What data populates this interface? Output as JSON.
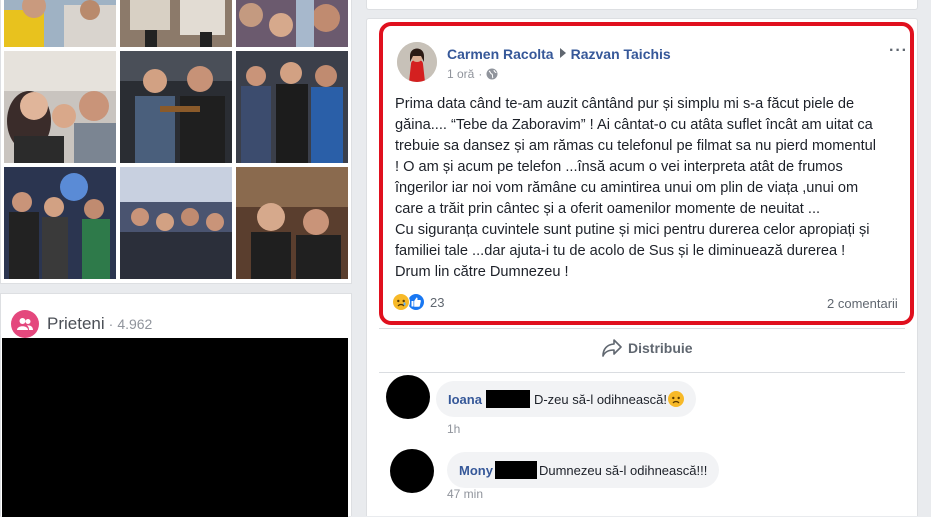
{
  "friends": {
    "title": "Prieteni",
    "separator": "·",
    "count": "4.962"
  },
  "post": {
    "author": "Carmen Racolta",
    "target": "Razvan Taichis",
    "time": "1 oră",
    "meta_dot": "·",
    "more": "···",
    "text_lines": [
      "Prima data când te-am auzit cântând pur și simplu mi s-a făcut piele de",
      "găina.... “Tebe da Zaboravim” ! Ai cântat-o cu atâta suflet încât am uitat ca",
      "trebuie sa dansez și am rămas cu telefonul pe filmat sa nu pierd momentul",
      "! O am și acum pe telefon ...însă acum o vei interpreta atât de frumos",
      "îngerilor iar noi vom rămâne cu amintirea unui om plin de viața ,unui om",
      "care a trăit prin cântec și a oferit oamenilor momente de neuitat ...",
      "Cu siguranța cuvintele sunt putine și mici pentru durerea celor apropiați și",
      "familiei tale ...dar ajuta-i tu de acolo de Sus și le diminuează durerea !",
      "Drum lin către Dumnezeu !"
    ],
    "reaction_count": "23",
    "comments_link": "2 comentarii",
    "share_label": "Distribuie"
  },
  "comments": [
    {
      "name": "Ioana",
      "text": "D-zeu să-l odihnească!",
      "time": "1h"
    },
    {
      "name": "Mony",
      "text": "Dumnezeu să-l odihnească!!!",
      "time": "47 min"
    }
  ],
  "colors": {
    "link_blue": "#365899",
    "highlight_red": "#e0101e",
    "friends_pink": "#e4487d"
  }
}
